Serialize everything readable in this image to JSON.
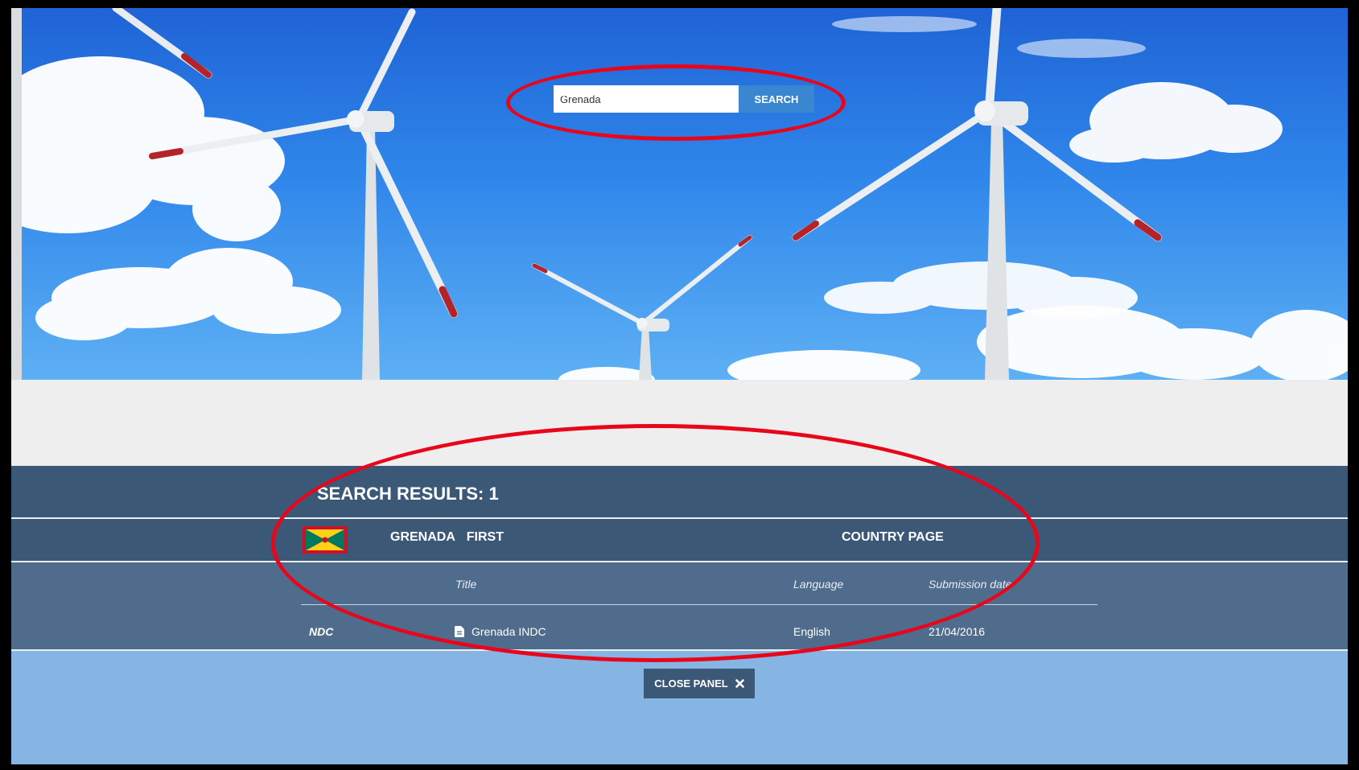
{
  "search": {
    "value": "Grenada",
    "button_label": "SEARCH"
  },
  "results": {
    "title": "SEARCH RESULTS: 1",
    "country": {
      "name": "GRENADA",
      "ndc_label": "FIRST",
      "link_label": "COUNTRY PAGE"
    },
    "table": {
      "headers": {
        "title": "Title",
        "language": "Language",
        "submission_date": "Submission date"
      },
      "rows": [
        {
          "type": "NDC",
          "title": "Grenada INDC",
          "language": "English",
          "submission_date": "21/04/2016"
        }
      ]
    }
  },
  "close_panel": {
    "label": "CLOSE PANEL"
  },
  "colors": {
    "panel": "#3c5877",
    "table": "#4f6c8c",
    "search_button": "#3b86d1",
    "annotation": "#e8061b"
  }
}
